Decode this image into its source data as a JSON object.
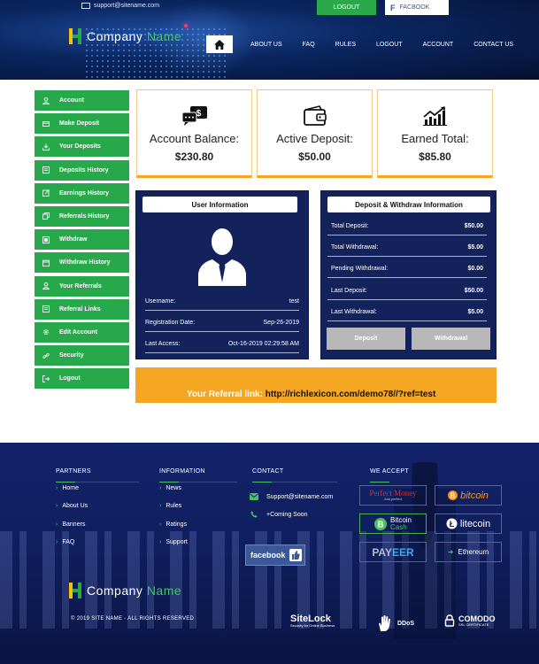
{
  "header": {
    "email": "support@sitename.com",
    "logout_label": "LOGOUT",
    "facebook_label": "FACBOOK",
    "logo_word1": "Company",
    "logo_word2": "Name",
    "nav": [
      "ABOUT US",
      "FAQ",
      "RULES",
      "LOGOUT",
      "ACCOUNT",
      "CONTACT US"
    ]
  },
  "sidebar": {
    "items": [
      {
        "label": "Account",
        "icon": "user-icon"
      },
      {
        "label": "Make Deposit",
        "icon": "credit-card-icon"
      },
      {
        "label": "Your Deposits",
        "icon": "download-icon"
      },
      {
        "label": "Deposits History",
        "icon": "list-icon"
      },
      {
        "label": "Earnings History",
        "icon": "edit-icon"
      },
      {
        "label": "Referrals History",
        "icon": "copy-icon"
      },
      {
        "label": "Withdraw",
        "icon": "document-icon"
      },
      {
        "label": "Withdraw History",
        "icon": "calendar-icon"
      },
      {
        "label": "Your Referrals",
        "icon": "user-icon"
      },
      {
        "label": "Referral Links",
        "icon": "list-icon"
      },
      {
        "label": "Edit Account",
        "icon": "gear-icon"
      },
      {
        "label": "Security",
        "icon": "link-icon"
      },
      {
        "label": "Logout",
        "icon": "logout-icon"
      }
    ]
  },
  "stats": [
    {
      "label": "Account Balance:",
      "value": "$230.80",
      "icon": "money-chat-icon"
    },
    {
      "label": "Active Deposit:",
      "value": "$50.00",
      "icon": "wallet-icon"
    },
    {
      "label": "Earned Total:",
      "value": "$85.80",
      "icon": "growth-chart-icon"
    }
  ],
  "user_info": {
    "title": "User Information",
    "rows": [
      {
        "label": "Username:",
        "value": "test"
      },
      {
        "label": "Registration Date:",
        "value": "Sep-26-2019"
      },
      {
        "label": "Last Access:",
        "value": "Oct-16-2019 02:29:58 AM"
      }
    ]
  },
  "deposit_withdraw": {
    "title": "Deposit & Withdraw Information",
    "rows": [
      {
        "label": "Total Deposit:",
        "value": "$50.00"
      },
      {
        "label": "Total Withdrawal:",
        "value": "$5.00"
      },
      {
        "label": "Pending Withdrawal:",
        "value": "$0.00"
      },
      {
        "label": "Last Deposit:",
        "value": "$50.00"
      },
      {
        "label": "Last Withdrawal:",
        "value": "$5.00"
      }
    ],
    "deposit_button": "Deposit",
    "withdrawal_button": "Withdrawal"
  },
  "referral": {
    "label": "Your Referral link:",
    "link": "http://richlexicon.com/demo78//?ref=test"
  },
  "footer": {
    "partners_title": "PARTNERS",
    "partners": [
      "Home",
      "About Us",
      "Banners",
      "FAQ"
    ],
    "information_title": "INFORMATION",
    "information": [
      "News",
      "Rules",
      "Ratings",
      "Support"
    ],
    "contact_title": "CONTACT",
    "contact_email": "Support@sitename.com",
    "contact_phone": "+Coming Soon",
    "facebook_button": "facebook",
    "accept_title": "WE ACCEPT",
    "payments": {
      "perfect_money": "Perfect Money",
      "perfect_money_sub": "Just perfect",
      "bitcoin": "bitcoin",
      "bitcoin_cash_1": "Bitcoin",
      "bitcoin_cash_2": "Cash",
      "litecoin": "litecoin",
      "payeer_1": "PAY",
      "payeer_2": "EER",
      "ethereum": "Ethereum"
    },
    "logo_word1": "Company",
    "logo_word2": "Name",
    "copyright": "© 2019 SITE NAME - ALL RIGHTS RESERVED",
    "sitelock": "SiteLock",
    "sitelock_sub": "Security for Online Business",
    "ddos": "DDoS",
    "comodo": "COMODO",
    "comodo_sub": "SSL CERTIFICATE"
  },
  "colors": {
    "green": "#27a94b",
    "navy": "#14225c",
    "orange": "#f5a623"
  }
}
